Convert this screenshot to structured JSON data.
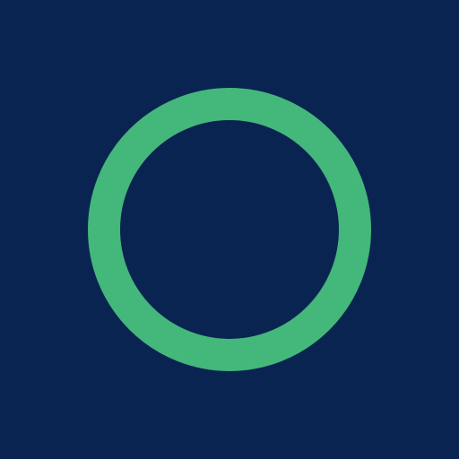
{
  "colors": {
    "background": "#0a2452",
    "ring": "#44b77a"
  },
  "icon": {
    "name": "ring-icon"
  }
}
